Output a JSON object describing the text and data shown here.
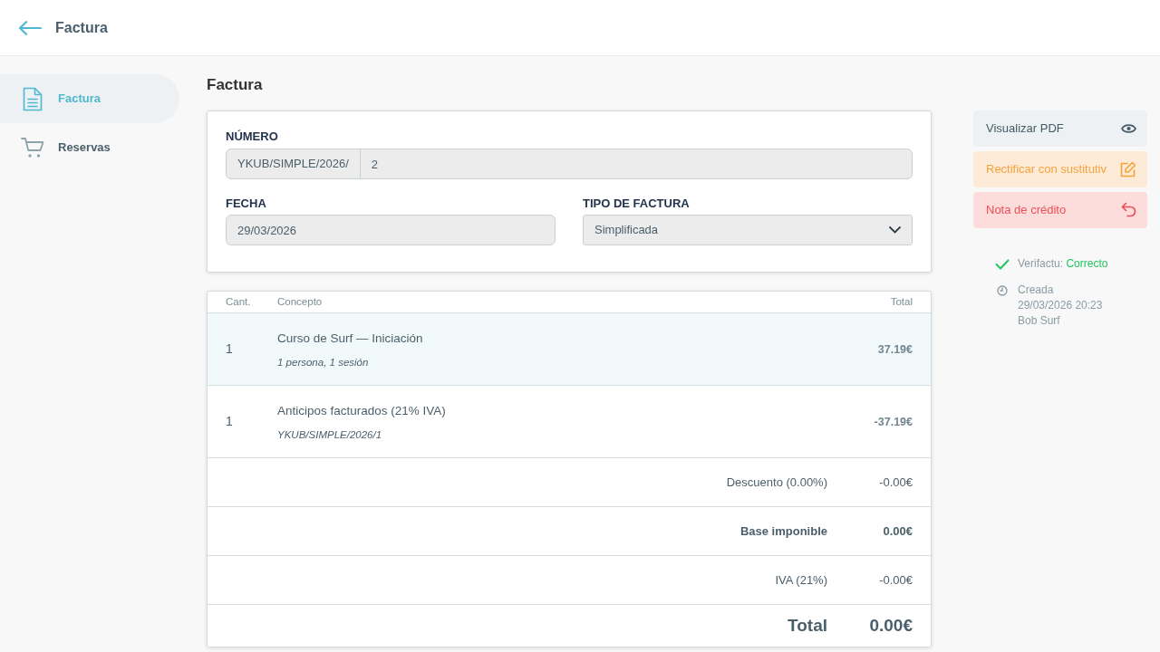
{
  "header": {
    "title": "Factura"
  },
  "sidebar": {
    "items": [
      {
        "label": "Factura",
        "selected": true
      },
      {
        "label": "Reservas",
        "selected": false
      }
    ]
  },
  "page_title": "Factura",
  "invoice_form": {
    "number": {
      "label": "NÚMERO",
      "prefix": "YKUB/SIMPLE/2026/",
      "value": "2",
      "disabled": true
    },
    "date": {
      "label": "FECHA",
      "value": "29/03/2026",
      "disabled": true
    },
    "invoice_type": {
      "label": "TIPO DE FACTURA",
      "value": "Simplificada",
      "disabled": true
    }
  },
  "lines": {
    "columns": [
      "Cant.",
      "Concepto",
      "Total"
    ],
    "rows": [
      {
        "quantity": "1",
        "concept": "Curso de Surf — Iniciación",
        "detail": "1 persona, 1 sesión",
        "total": "37.19€",
        "selected": true
      },
      {
        "quantity": "1",
        "concept": "Anticipos facturados (21% IVA)",
        "detail": "YKUB/SIMPLE/2026/1",
        "total": "-37.19€",
        "selected": false
      }
    ]
  },
  "totals": [
    {
      "label": "Descuento (0.00%)",
      "value": "-0.00€",
      "kind": "normal"
    },
    {
      "label": "Base imponible",
      "value": "0.00€",
      "kind": "subtotal"
    },
    {
      "label": "IVA (21%)",
      "value": "-0.00€",
      "kind": "normal"
    },
    {
      "label": "Total",
      "value": "0.00€",
      "kind": "grand"
    }
  ],
  "actions": [
    {
      "label": "Visualizar PDF",
      "kind": "neutral"
    },
    {
      "label": "Rectificar con sustitutiv",
      "kind": "warning"
    },
    {
      "label": "Nota de crédito",
      "kind": "danger"
    }
  ],
  "status": {
    "verifactu": {
      "label": "Verifactu:",
      "value": "Correcto"
    },
    "created": {
      "label": "Creada",
      "date": "29/03/2026 20:23",
      "user": "Bob Surf"
    }
  }
}
